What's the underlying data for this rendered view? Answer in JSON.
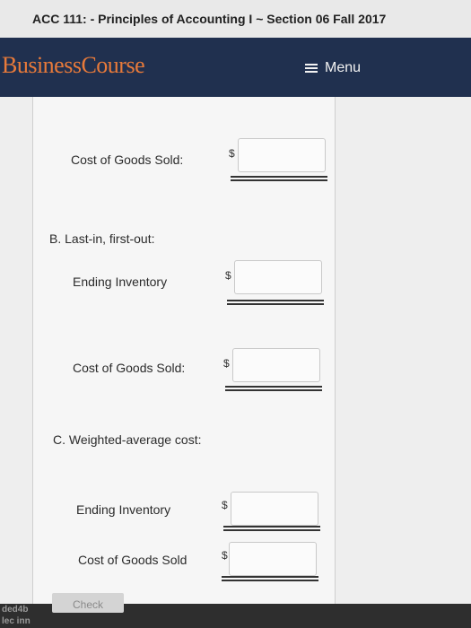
{
  "header": {
    "title": "ACC 111: - Principles of Accounting I ~ Section 06 Fall 2017"
  },
  "navbar": {
    "brand": "BusinessCourse",
    "menu_label": "Menu"
  },
  "form": {
    "currency_symbol": "$",
    "section_a": {
      "cogs_label": "Cost of Goods Sold:",
      "cogs_value": ""
    },
    "section_b": {
      "heading": "B.  Last-in, first-out:",
      "ending_inventory_label": "Ending Inventory",
      "ending_inventory_value": "",
      "cogs_label": "Cost of Goods Sold:",
      "cogs_value": ""
    },
    "section_c": {
      "heading": "C.  Weighted-average cost:",
      "ending_inventory_label": "Ending Inventory",
      "ending_inventory_value": "",
      "cogs_label": "Cost of Goods Sold",
      "cogs_value": ""
    },
    "check_label": "Check"
  },
  "sidebar_fragments": [
    "ded4b",
    "lec inn"
  ],
  "colors": {
    "navbar_bg": "#20304f",
    "brand_orange": "#e87a3a",
    "menu_text": "#f2f2f2"
  }
}
